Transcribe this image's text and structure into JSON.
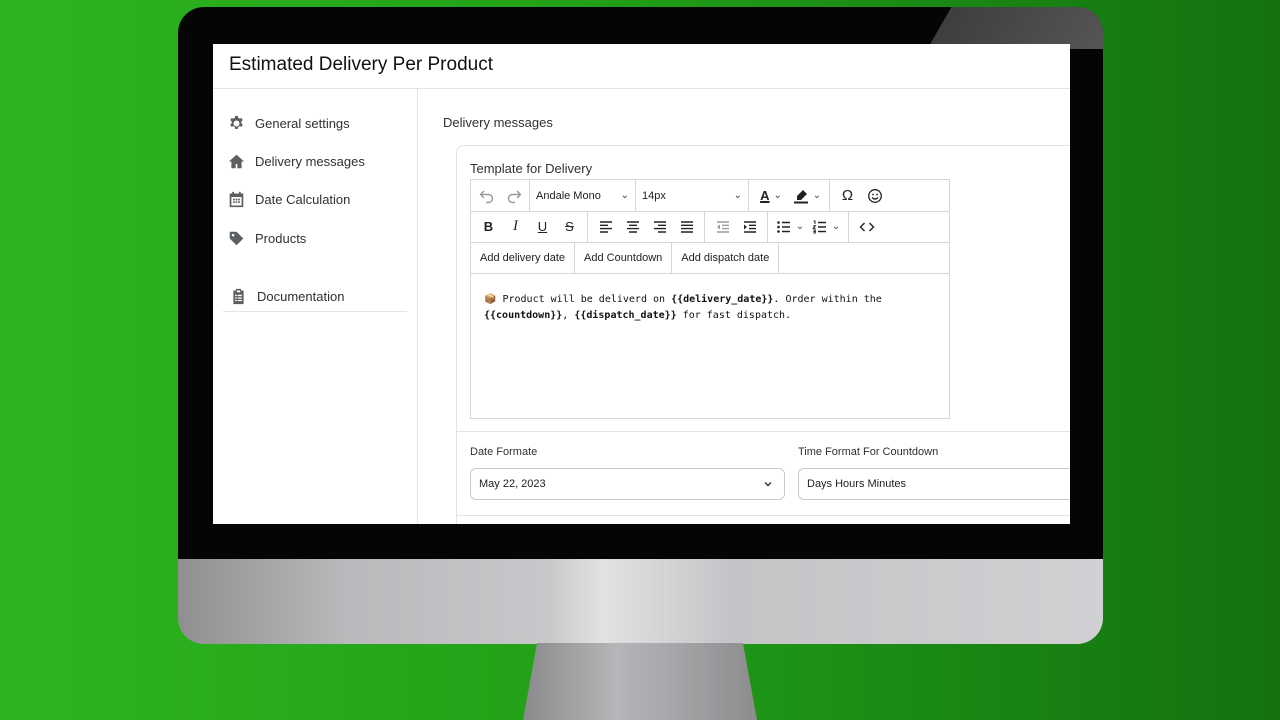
{
  "app": {
    "title": "Estimated Delivery Per Product"
  },
  "sidebar": {
    "items": [
      {
        "label": "General settings",
        "icon": "gear-icon"
      },
      {
        "label": "Delivery messages",
        "icon": "home-icon"
      },
      {
        "label": "Date Calculation",
        "icon": "calendar-icon"
      },
      {
        "label": "Products",
        "icon": "tag-icon"
      }
    ],
    "documentation": {
      "label": "Documentation",
      "icon": "clipboard-icon"
    }
  },
  "main": {
    "section_title": "Delivery messages",
    "template_label": "Template for Delivery",
    "editor": {
      "font_family": "Andale Mono",
      "font_size": "14px",
      "actions": [
        "Add delivery date",
        "Add Countdown",
        "Add dispatch date"
      ],
      "content": {
        "emoji": "📦",
        "part1": " Product will be deliverd on ",
        "ph1": "{{delivery_date}}",
        "part2": ". Order within the",
        "ph2": "{{countdown}}",
        "part3": ", ",
        "ph3": "{{dispatch_date}}",
        "part4": " for fast dispatch."
      }
    },
    "date_format": {
      "label": "Date Formate",
      "value": "May 22, 2023"
    },
    "time_format": {
      "label": "Time Format For Countdown",
      "value": "Days Hours Minutes"
    }
  }
}
